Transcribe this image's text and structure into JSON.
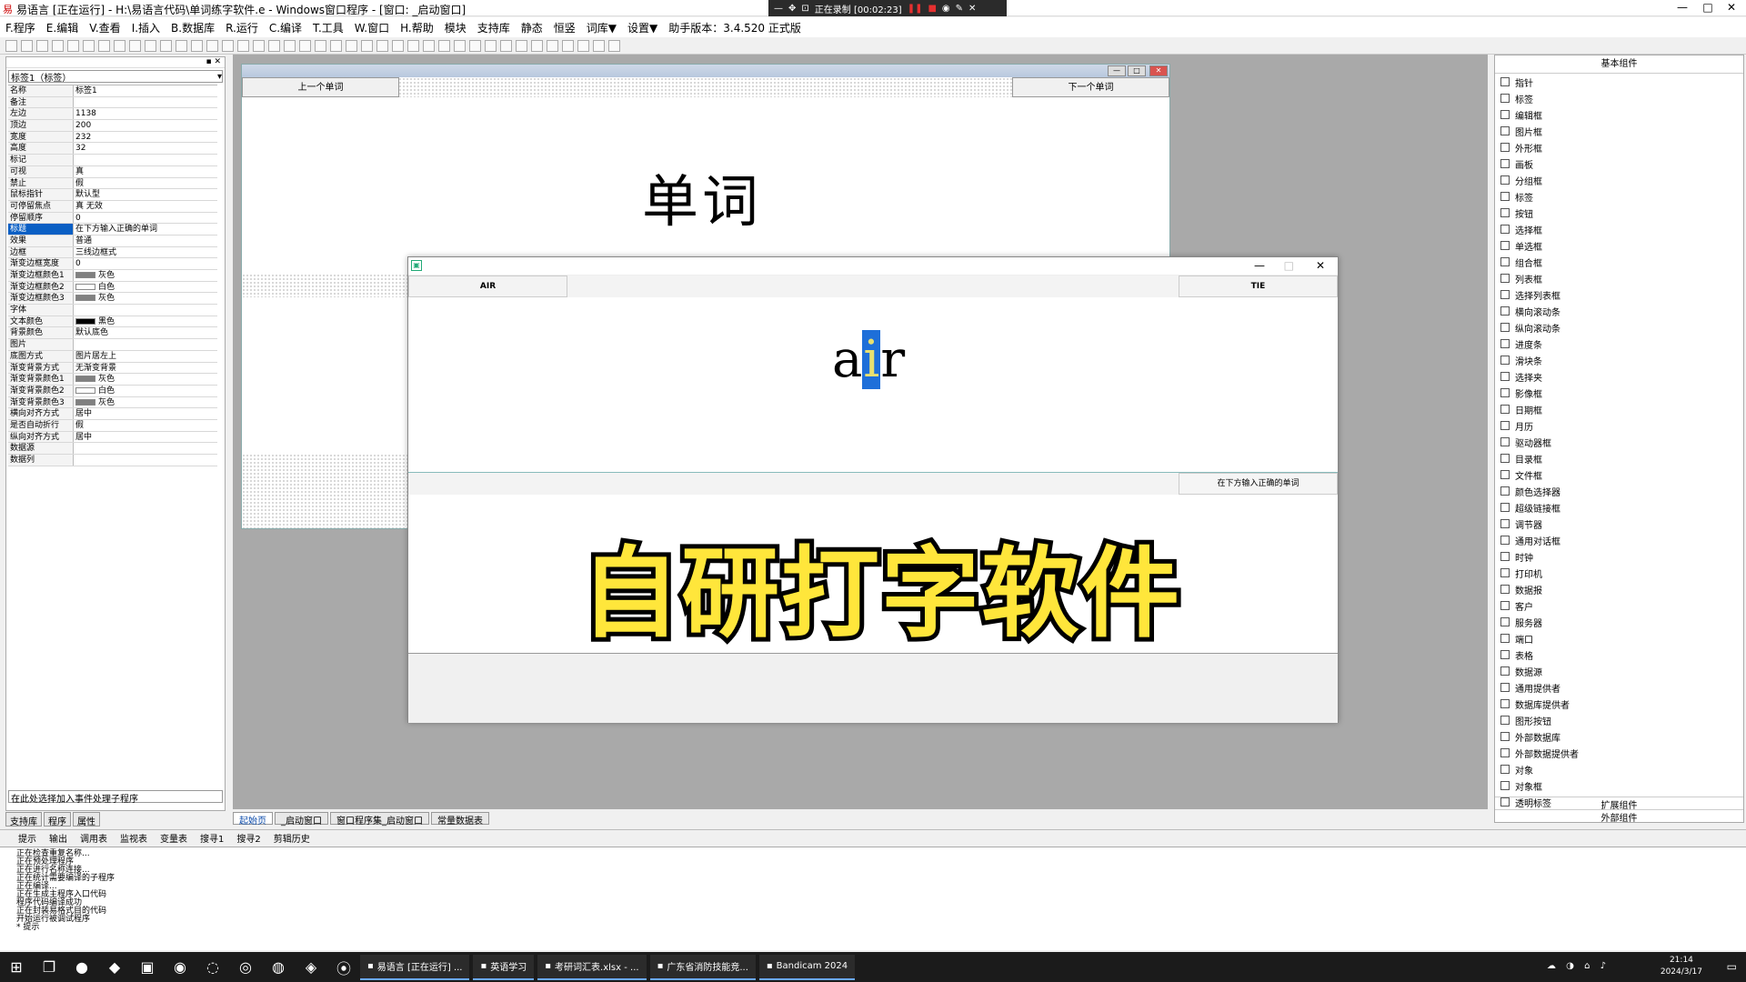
{
  "window": {
    "title": "易语言 [正在运行] - H:\\易语言代码\\单词练字软件.e - Windows窗口程序 - [窗口: _启动窗口]",
    "min": "—",
    "max": "□",
    "close": "✕"
  },
  "recorder": {
    "status": "正在录制 [00:02:23]"
  },
  "menu": [
    "F.程序",
    "E.编辑",
    "V.查看",
    "I.插入",
    "B.数据库",
    "R.运行",
    "C.编译",
    "T.工具",
    "W.窗口",
    "H.帮助",
    "模块",
    "支持库",
    "静态",
    "恒竖",
    "词库▼",
    "设置▼",
    "助手版本：3.4.520 正式版"
  ],
  "left_panel": {
    "selector": "标签1（标签）",
    "properties": [
      {
        "k": "名称",
        "v": "标签1"
      },
      {
        "k": "备注",
        "v": ""
      },
      {
        "k": "左边",
        "v": "1138"
      },
      {
        "k": "顶边",
        "v": "200"
      },
      {
        "k": "宽度",
        "v": "232"
      },
      {
        "k": "高度",
        "v": "32"
      },
      {
        "k": "标记",
        "v": ""
      },
      {
        "k": "可视",
        "v": "真"
      },
      {
        "k": "禁止",
        "v": "假"
      },
      {
        "k": "鼠标指针",
        "v": "默认型"
      },
      {
        "k": "可停留焦点",
        "v": "真 无效"
      },
      {
        "k": "停留顺序",
        "v": "0"
      },
      {
        "k": "标题",
        "v": "在下方输入正确的单词",
        "sel": true
      },
      {
        "k": "效果",
        "v": "普通"
      },
      {
        "k": "边框",
        "v": "三线边框式"
      },
      {
        "k": "渐变边框宽度",
        "v": "0"
      },
      {
        "k": "渐变边框颜色1",
        "v": "灰色",
        "sw": "#808080"
      },
      {
        "k": "渐变边框颜色2",
        "v": "白色",
        "sw": "#ffffff"
      },
      {
        "k": "渐变边框颜色3",
        "v": "灰色",
        "sw": "#808080"
      },
      {
        "k": "字体",
        "v": ""
      },
      {
        "k": "文本颜色",
        "v": "黑色",
        "sw": "#000000"
      },
      {
        "k": "背景颜色",
        "v": "默认底色"
      },
      {
        "k": "图片",
        "v": ""
      },
      {
        "k": "底图方式",
        "v": "图片居左上"
      },
      {
        "k": "渐变背景方式",
        "v": "无渐变背景"
      },
      {
        "k": "渐变背景颜色1",
        "v": "灰色",
        "sw": "#808080"
      },
      {
        "k": "渐变背景颜色2",
        "v": "白色",
        "sw": "#ffffff"
      },
      {
        "k": "渐变背景颜色3",
        "v": "灰色",
        "sw": "#808080"
      },
      {
        "k": "横向对齐方式",
        "v": "居中"
      },
      {
        "k": "是否自动折行",
        "v": "假"
      },
      {
        "k": "纵向对齐方式",
        "v": "居中"
      },
      {
        "k": "数据源",
        "v": ""
      },
      {
        "k": "数据列",
        "v": ""
      }
    ],
    "event_combo": "在此处选择加入事件处理子程序",
    "tabs": [
      "支持库",
      "程序",
      "属性"
    ]
  },
  "form_designer": {
    "prev_button": "上一个单词",
    "next_button": "下一个单词",
    "word": "单词"
  },
  "run_window": {
    "left_button": "AIR",
    "right_button": "TIE",
    "word_a": "a",
    "word_cursor": "i",
    "word_rest": "r",
    "hint": "在下方输入正确的单词",
    "overlay_text": "自研打字软件"
  },
  "right_panel": {
    "title": "基本组件",
    "components": [
      "指针",
      "标签",
      "编辑框",
      "图片框",
      "外形框",
      "画板",
      "分组框",
      "标签",
      "按钮",
      "选择框",
      "单选框",
      "组合框",
      "列表框",
      "选择列表框",
      "横向滚动条",
      "纵向滚动条",
      "进度条",
      "滑块条",
      "选择夹",
      "影像框",
      "日期框",
      "月历",
      "驱动器框",
      "目录框",
      "文件框",
      "颜色选择器",
      "超级链接框",
      "调节器",
      "通用对话框",
      "时钟",
      "打印机",
      "数据报",
      "客户",
      "服务器",
      "端口",
      "表格",
      "数据源",
      "通用提供者",
      "数据库提供者",
      "图形按钮",
      "外部数据库",
      "外部数据提供者",
      "对象",
      "对象框",
      "透明标签"
    ],
    "footer": [
      "扩展组件",
      "外部组件"
    ]
  },
  "doc_tabs": [
    "起始页",
    "_启动窗口",
    "窗口程序集_启动窗口",
    "常量数据表"
  ],
  "output_tabs": [
    "提示",
    "输出",
    "调用表",
    "监视表",
    "变量表",
    "搜寻1",
    "搜寻2",
    "剪辑历史"
  ],
  "output_lines": [
    "正在检查重复名称...",
    "正在预处理程序",
    "正在进行名称连接...",
    "正在统计需要编译的子程序",
    "正在编译...",
    "正在生成主程序入口代码",
    "程序代码编译成功",
    "正在封装易格式目的代码",
    "开始运行被调试程序",
    "* 提示"
  ],
  "taskbar": {
    "windows": [
      "易语言 [正在运行] ...",
      "英语学习",
      "考研词汇表.xlsx - ...",
      "广东省消防技能竞...",
      "Bandicam 2024"
    ],
    "time": "21:14",
    "date": "2024/3/17",
    "ime": "英"
  }
}
